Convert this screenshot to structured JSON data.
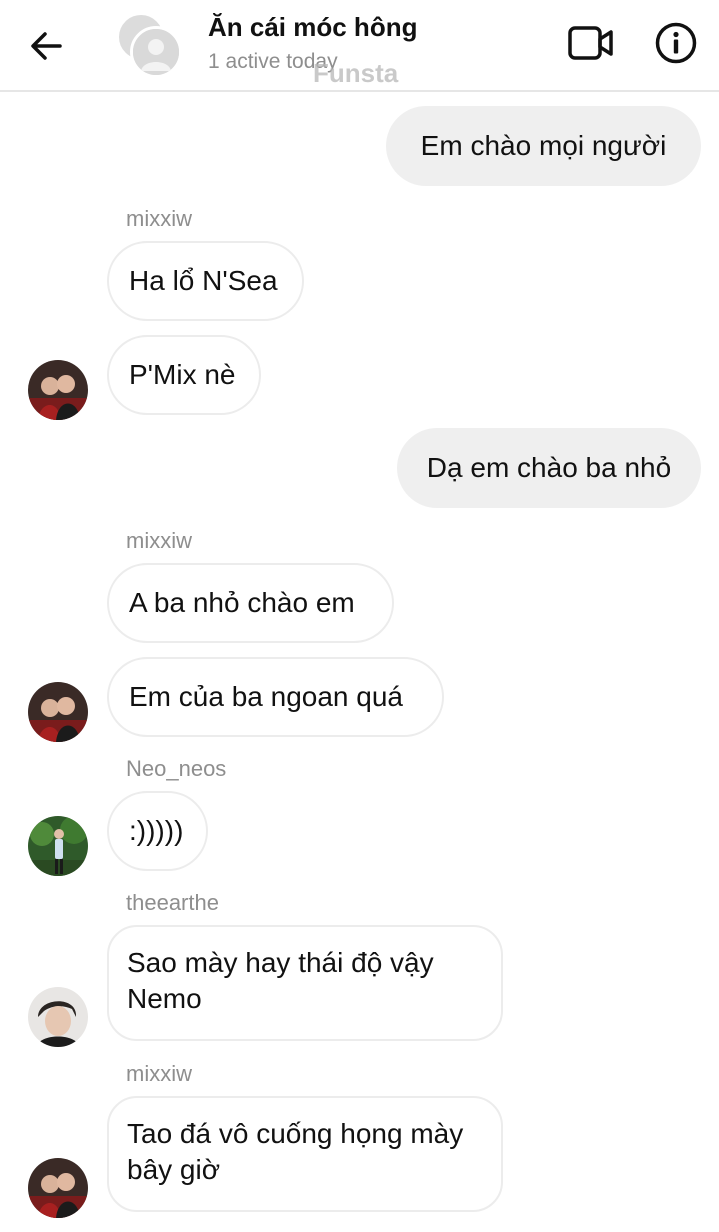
{
  "header": {
    "title": "Ăn cái móc hông",
    "status": "1 active today",
    "watermark": "Funsta"
  },
  "messages": {
    "m1": "Em chào mọi người",
    "s1": "mixxiw",
    "m2": "Ha lổ N'Sea",
    "m3": "P'Mix nè",
    "m4": "Dạ em chào ba nhỏ",
    "s2": "mixxiw",
    "m5": "A ba nhỏ chào em",
    "m6": "Em của ba ngoan quá",
    "s3": "Neo_neos",
    "m7": ":)))))",
    "s4": "theearthe",
    "m8": "Sao mày hay thái độ vậy Nemo",
    "s5": "mixxiw",
    "m9": "Tao đá vô cuống họng mày bây giờ"
  }
}
